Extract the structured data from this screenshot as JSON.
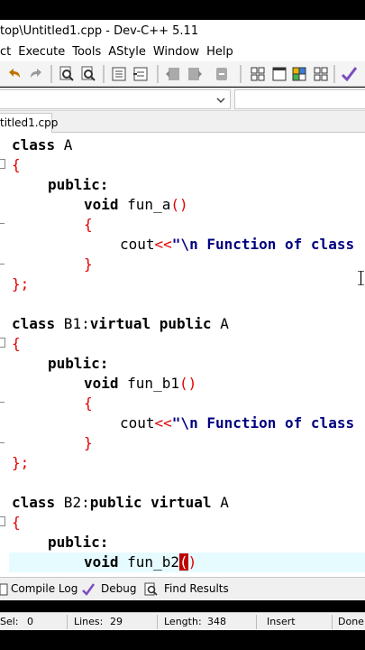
{
  "window": {
    "title": "top\\Untitled1.cpp - Dev-C++ 5.11"
  },
  "menu": [
    "ct",
    "Execute",
    "Tools",
    "AStyle",
    "Window",
    "Help"
  ],
  "tab": {
    "label": "titled1.cpp"
  },
  "code": [
    {
      "k": "class",
      "rest": " A"
    },
    {
      "b": "{"
    },
    {
      "pub": "public:"
    },
    {
      "t": "void",
      "rest": " fun_a",
      "p": "()"
    },
    {
      "b": "{"
    },
    {
      "cout": "cout",
      "op": "<<",
      "s": "\"\\n Function of class"
    },
    {
      "b": "}"
    },
    {
      "b": "};"
    },
    {
      "k": "class",
      "rest": " B1:",
      "k2": "virtual public",
      "rest2": " A"
    },
    {
      "b": "{"
    },
    {
      "pub": "public:"
    },
    {
      "t": "void",
      "rest": " fun_b1",
      "p": "()"
    },
    {
      "b": "{"
    },
    {
      "cout": "cout",
      "op": "<<",
      "s": "\"\\n Function of class"
    },
    {
      "b": "}"
    },
    {
      "b": "};"
    },
    {
      "k": "class",
      "rest": " B2:",
      "k2": "public virtual",
      "rest2": " A"
    },
    {
      "b": "{"
    },
    {
      "pub": "public:"
    },
    {
      "t": "void",
      "rest": " fun_b2",
      "p1": "(",
      "p2": ")"
    }
  ],
  "bottom_tabs": [
    "Compile Log",
    "Debug",
    "Find Results"
  ],
  "status": {
    "sel_label": "Sel:",
    "sel": "0",
    "lines_label": "Lines:",
    "lines": "29",
    "length_label": "Length:",
    "length": "348",
    "mode": "Insert",
    "state": "Done"
  },
  "colors": {
    "brace": "#e00000",
    "string": "#000080",
    "current_line": "#e6fbff"
  }
}
